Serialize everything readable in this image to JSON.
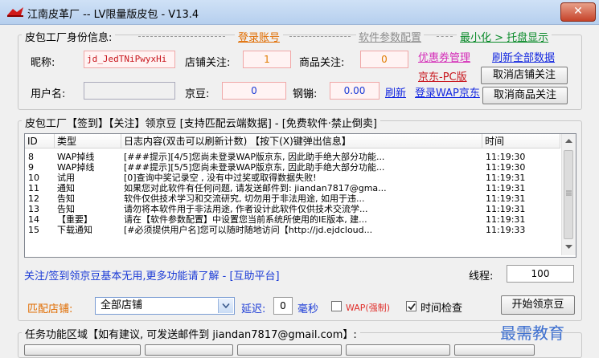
{
  "window": {
    "title": "江南皮革厂  --  LV限量版皮包 - V13.4",
    "close_label": "✕"
  },
  "identity": {
    "legend": "皮包工厂身份信息:",
    "login_link": "登录账号",
    "params_link": "软件参数配置",
    "minimize_link": "最小化 > 托盘显示",
    "nickname_label": "昵称:",
    "nickname_value": "jd_JedTNiPwyxHi",
    "shop_follow_label": "店铺关注:",
    "shop_follow_value": "1",
    "goods_follow_label": "商品关注:",
    "goods_follow_value": "0",
    "coupon_link": "优惠券管理",
    "refresh_all_link": "刷新全部数据",
    "pc_version_link": "京东-PC版",
    "unfollow_shop_btn": "取消店铺关注",
    "username_label": "用户名:",
    "username_value": "",
    "jingdou_label": "京豆:",
    "jingdou_value": "0",
    "gangbeng_label": "钢镚:",
    "gangbeng_value": "0.00",
    "refresh_link": "刷新",
    "wap_login_link": "登录WAP京东",
    "unfollow_goods_btn": "取消商品关注"
  },
  "signin": {
    "legend": "皮包工厂【签到】【关注】领京豆 [支持匹配云端数据] - [免费软件·禁止倒卖]",
    "columns": [
      "ID",
      "类型",
      "日志内容(双击可以刷新计数) 【按下(X)键弹出信息】",
      "时间"
    ],
    "rows": [
      {
        "id": "8",
        "type": "WAP掉线",
        "content": "[###提示][4/5]您尚未登录WAP版京东, 因此助手绝大部分功能...",
        "time": "11:19:30"
      },
      {
        "id": "9",
        "type": "WAP掉线",
        "content": "[###提示][5/5]您尚未登录WAP版京东, 因此助手绝大部分功能...",
        "time": "11:19:30"
      },
      {
        "id": "10",
        "type": "试用",
        "content": "[0]查询中奖记录空 , 没有中过奖或取得数据失败!",
        "time": "11:19:31"
      },
      {
        "id": "11",
        "type": "通知",
        "content": "如果您对此软件有任何问题, 请发送邮件到: jiandan7817@gma...",
        "time": "11:19:31"
      },
      {
        "id": "12",
        "type": "告知",
        "content": "软件仅供技术学习和交流研究, 切勿用于非法用途, 如用于违...",
        "time": "11:19:31"
      },
      {
        "id": "13",
        "type": "告知",
        "content": "请勿将本软件用于非法用途, 作者设计此软件仅供技术交流学...",
        "time": "11:19:31"
      },
      {
        "id": "14",
        "type": "【重要】",
        "content": "请在【软件参数配置】中设置您当前系统所使用的IE版本, 建...",
        "time": "11:19:31"
      },
      {
        "id": "15",
        "type": "下载通知",
        "content": "[#必须提供用户名]您可以随时随地访问【http://jd.ejdcloud...",
        "time": "11:19:33"
      }
    ],
    "notice_text": "关注/签到领京豆基本无用,更多功能请了解 - [互助平台]",
    "threads_label": "线程:",
    "threads_value": "100",
    "match_shop_label": "匹配店铺:",
    "shop_select_value": "全部店铺",
    "delay_label": "延迟:",
    "delay_value": "0",
    "delay_unit": "毫秒",
    "wap_force_label": "WAP(强制)",
    "time_check_label": "时间检查",
    "start_btn": "开始领京豆"
  },
  "tasks": {
    "legend": "任务功能区域【如有建议, 可发送邮件到 jiandan7817@gmail.com】:",
    "watermark": "最需教育"
  }
}
